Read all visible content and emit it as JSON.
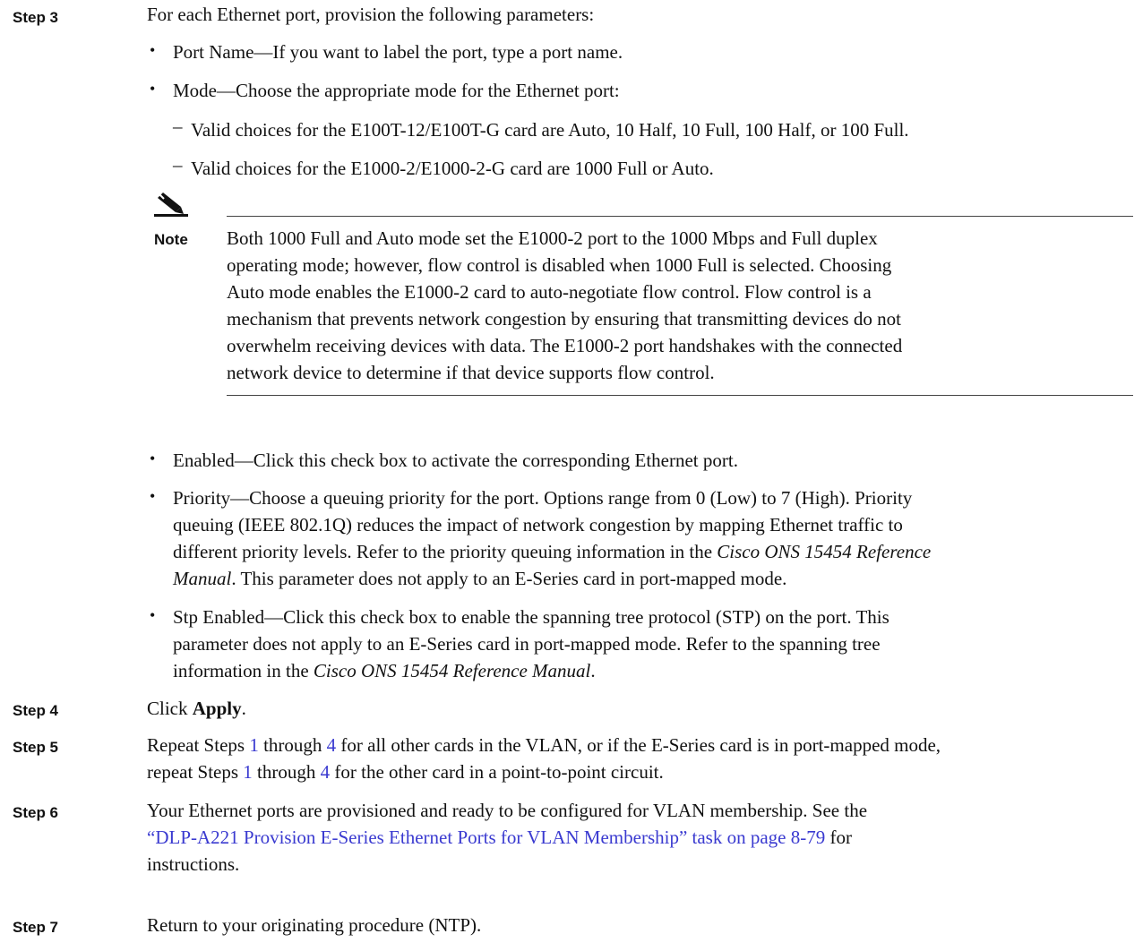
{
  "step3": {
    "label": "Step 3",
    "text": "For each Ethernet port, provision the following parameters:",
    "port_name": "Port Name—If you want to label the port, type a port name.",
    "mode": "Mode—Choose the appropriate mode for the Ethernet port:",
    "mode_choice_1": "Valid choices for the E100T-12/E100T-G card are Auto, 10 Half, 10 Full, 100 Half, or 100 Full.",
    "mode_choice_2": "Valid choices for the E1000-2/E1000-2-G card are 1000 Full or Auto.",
    "note_label": "Note",
    "note_lines": [
      "Both 1000 Full and Auto mode set the E1000-2 port to the 1000 Mbps and Full duplex",
      "operating mode; however, flow control is disabled when 1000 Full is selected. Choosing",
      "Auto mode enables the E1000-2 card to auto-negotiate flow control. Flow control is a",
      "mechanism that prevents network congestion by ensuring that transmitting devices do not",
      "overwhelm receiving devices with data. The E1000-2 port handshakes with the connected",
      "network device to determine if that device supports flow control."
    ],
    "enabled": "Enabled—Click this check box to activate the corresponding Ethernet port.",
    "priority_lines": [
      "Priority—Choose a queuing priority for the port. Options range from 0 (Low) to 7 (High). Priority",
      "queuing (IEEE 802.1Q) reduces the impact of network congestion by mapping Ethernet traffic to",
      "different priority levels. Refer to the priority queuing information in the ",
      "Cisco ONS 15454 Reference",
      "Manual",
      ". This parameter does not apply to an E-Series card in port-mapped mode."
    ],
    "stp_lines": [
      "Stp Enabled—Click this check box to enable the spanning tree protocol (STP) on the port. This",
      "parameter does not apply to an E-Series card in port-mapped mode. Refer to the spanning tree",
      "information in the ",
      "Cisco ONS 15454 Reference Manual",
      "."
    ]
  },
  "step4": {
    "label": "Step 4",
    "pre": "Click ",
    "bold": "Apply",
    "post": "."
  },
  "step5": {
    "label": "Step 5",
    "line1": [
      "Repeat Steps ",
      "1",
      " through ",
      "4",
      " for all other cards in the VLAN, or if the E-Series card is in port-mapped mode,"
    ],
    "line2": [
      "repeat Steps ",
      "1",
      " through ",
      "4",
      " for the other card in a point-to-point circuit."
    ]
  },
  "step6": {
    "label": "Step 6",
    "line1": "Your Ethernet ports are provisioned and ready to be configured for VLAN membership. See the",
    "link": "“DLP-A221 Provision E-Series Ethernet Ports for VLAN Membership” task on page 8-79",
    "after_link": " for",
    "line3": "instructions."
  },
  "step7": {
    "label": "Step 7",
    "text": "Return to your originating procedure (NTP)."
  },
  "bullet_char": "•",
  "dash_char": "–"
}
